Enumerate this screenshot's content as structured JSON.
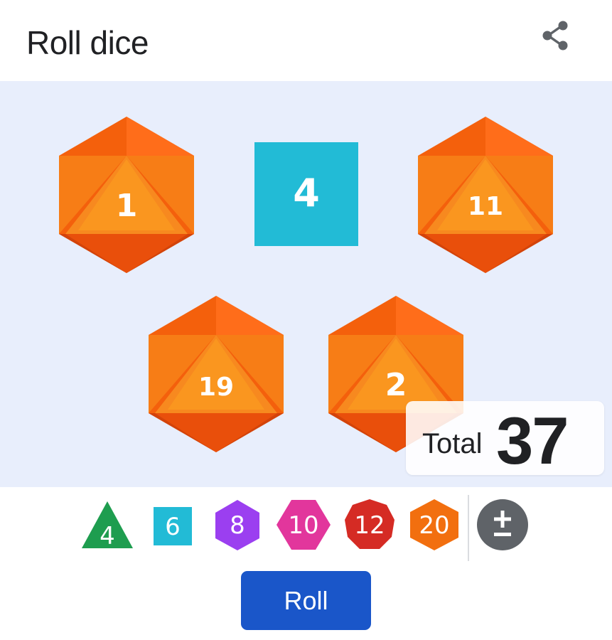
{
  "header": {
    "title": "Roll dice",
    "share_icon": "share-icon"
  },
  "dice": [
    {
      "kind": "d20",
      "value": "1"
    },
    {
      "kind": "d6",
      "value": "4"
    },
    {
      "kind": "d20",
      "value": "11"
    },
    {
      "kind": "d20",
      "value": "19"
    },
    {
      "kind": "d20",
      "value": "2"
    }
  ],
  "total": {
    "label": "Total",
    "value": "37"
  },
  "picker": {
    "d4": "4",
    "d6": "6",
    "d8": "8",
    "d10": "10",
    "d12": "12",
    "d20": "20",
    "modifier_icon": "plus-minus-icon"
  },
  "roll_label": "Roll",
  "colors": {
    "d20": "#f26f0f",
    "d6": "#22bbd6",
    "d4": "#1e9d4f",
    "d8": "#9b3ff0",
    "d10": "#e2369c",
    "d12": "#d52b24",
    "modifier": "#5f6368",
    "stage_bg": "#e8eefc",
    "roll_button": "#1a56c9"
  }
}
